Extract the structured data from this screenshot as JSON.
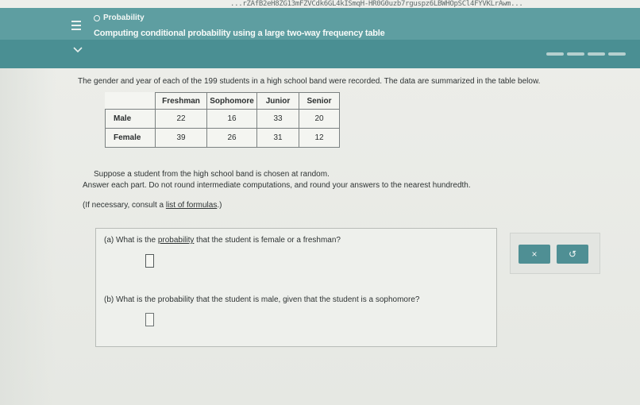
{
  "url_fragment": "...rZAfB2eH8ZG13mFZVCdk6GL4kISmqH-HR0G0uzb7rguspz6LBWHOpSCl4FYVKLrAwm...",
  "header": {
    "topic": "Probability",
    "lesson_title": "Computing conditional probability using a large two-way frequency table"
  },
  "prompt": {
    "intro": "The gender and year of each of the 199 students in a high school band were recorded. The data are summarized in the table below.",
    "suppose": "Suppose a student from the high school band is chosen at random.",
    "answer_each": "Answer each part. Do not round intermediate computations, and round your answers to the nearest hundredth.",
    "consult_prefix": "(If necessary, consult a ",
    "consult_link": "list of formulas",
    "consult_suffix": ".)"
  },
  "table": {
    "columns": [
      "Freshman",
      "Sophomore",
      "Junior",
      "Senior"
    ],
    "rows": [
      {
        "label": "Male",
        "values": [
          "22",
          "16",
          "33",
          "20"
        ]
      },
      {
        "label": "Female",
        "values": [
          "39",
          "26",
          "31",
          "12"
        ]
      }
    ]
  },
  "questions": {
    "a_prefix": "(a) What is the ",
    "a_link": "probability",
    "a_suffix": " that the student is female or a freshman?",
    "a_value": "",
    "b_text": "(b) What is the probability that the student is male, given that the student is a sophomore?",
    "b_value": ""
  },
  "buttons": {
    "clear": "×",
    "undo": "↺"
  },
  "colors": {
    "header": "#4a8f93",
    "button": "#4f8f94"
  }
}
